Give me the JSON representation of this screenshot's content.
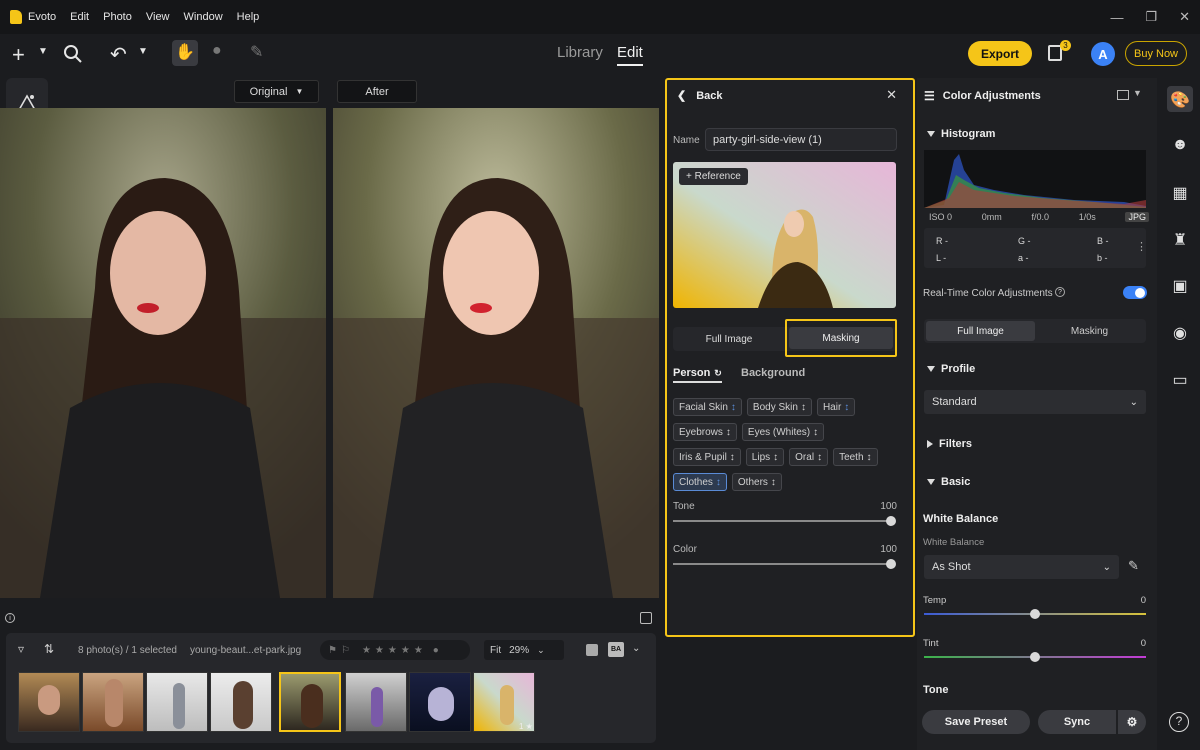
{
  "menubar": {
    "app": "Evoto",
    "items": [
      "Edit",
      "Photo",
      "View",
      "Window",
      "Help"
    ]
  },
  "toolbar": {
    "library": "Library",
    "edit": "Edit",
    "export": "Export",
    "badge": "3",
    "avatar": "A",
    "buy": "Buy Now"
  },
  "viewer": {
    "original": "Original",
    "after": "After"
  },
  "mask": {
    "back": "Back",
    "name_label": "Name",
    "name_value": "party-girl-side-view (1)",
    "reference": "+ Reference",
    "full_image": "Full Image",
    "masking": "Masking",
    "person": "Person",
    "background": "Background",
    "chips": [
      [
        "Facial Skin",
        "Body Skin",
        "Hair"
      ],
      [
        "Eyebrows",
        "Eyes (Whites)"
      ],
      [
        "Iris & Pupil",
        "Lips",
        "Oral",
        "Teeth"
      ],
      [
        "Clothes",
        "Others"
      ]
    ],
    "tone": "Tone",
    "tone_value": "100",
    "color": "Color",
    "color_value": "100"
  },
  "right": {
    "title": "Color Adjustments",
    "histogram": "Histogram",
    "iso": "ISO 0",
    "mm": "0mm",
    "f": "f/0.0",
    "shutter": "1/0s",
    "format": "JPG",
    "r": "R -",
    "g": "G -",
    "b": "B -",
    "l": "L -",
    "a": "a -",
    "bb": "b -",
    "realtime": "Real-Time Color Adjustments",
    "full_image": "Full Image",
    "masking": "Masking",
    "profile": "Profile",
    "profile_value": "Standard",
    "filters": "Filters",
    "basic": "Basic",
    "wb_title": "White Balance",
    "wb_label": "White Balance",
    "wb_value": "As Shot",
    "temp": "Temp",
    "temp_value": "0",
    "tint": "Tint",
    "tint_value": "0",
    "tone": "Tone",
    "save_preset": "Save Preset",
    "sync": "Sync"
  },
  "film": {
    "count": "8 photo(s) / 1 selected",
    "file": "young-beaut...et-park.jpg",
    "fit": "Fit",
    "zoom": "29%",
    "ba": "BA",
    "stars_thumb": "1 ★"
  },
  "colors": {
    "accent": "#f5c518",
    "toggle": "#3b82f6"
  }
}
